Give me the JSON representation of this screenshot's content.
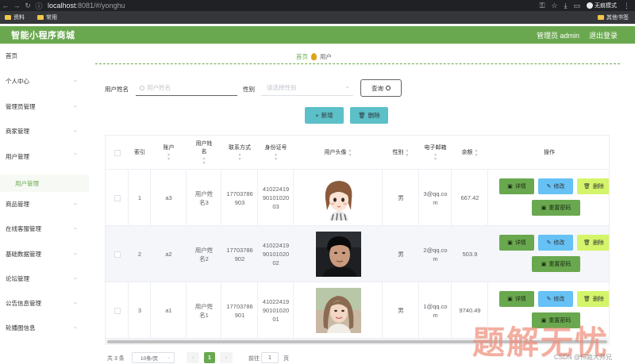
{
  "browser": {
    "url_host": "localhost",
    "url_path": ":8081/#/yonghu",
    "incognito_label": "无痕模式",
    "bookmarks": [
      "资料",
      "常用"
    ],
    "bookmarks_other": "其他书签"
  },
  "header": {
    "title": "智能小程序商城",
    "user": "管理员 admin",
    "logout": "退出登录"
  },
  "sidebar": {
    "items": [
      {
        "label": "首页",
        "has_children": false
      },
      {
        "label": "个人中心",
        "has_children": true
      },
      {
        "label": "管理员管理",
        "has_children": true
      },
      {
        "label": "商家管理",
        "has_children": true
      },
      {
        "label": "用户管理",
        "has_children": true
      },
      {
        "label": "商品管理",
        "has_children": true
      },
      {
        "label": "在线客服管理",
        "has_children": true
      },
      {
        "label": "基础数据管理",
        "has_children": true
      },
      {
        "label": "论坛管理",
        "has_children": true
      },
      {
        "label": "公告信息管理",
        "has_children": true
      },
      {
        "label": "轮播图信息",
        "has_children": true
      }
    ],
    "active_submenu": "用户管理"
  },
  "breadcrumb": {
    "home": "首页",
    "current": "用户"
  },
  "search": {
    "name_label": "用户姓名",
    "name_placeholder": "用户姓名",
    "gender_label": "性别",
    "gender_placeholder": "请选择性别",
    "query_button": "查询"
  },
  "actions": {
    "add": "新增",
    "delete": "删除"
  },
  "table": {
    "columns": [
      {
        "label": "",
        "sortable": false
      },
      {
        "label": "索引",
        "sortable": false
      },
      {
        "label": "账户",
        "sortable": true
      },
      {
        "label": "用户姓名",
        "sortable": true
      },
      {
        "label": "联系方式",
        "sortable": true
      },
      {
        "label": "身份证号",
        "sortable": true
      },
      {
        "label": "用户头像",
        "sortable": true
      },
      {
        "label": "性别",
        "sortable": true
      },
      {
        "label": "电子邮箱",
        "sortable": true
      },
      {
        "label": "余额",
        "sortable": true
      },
      {
        "label": "操作",
        "sortable": false
      }
    ],
    "rows": [
      {
        "index": "1",
        "account": "a3",
        "name": "用户姓名3",
        "phone": "17703786903",
        "id_card": "410224199010102003",
        "avatar": "cartoon-girl",
        "gender": "男",
        "email": "3@qq.com",
        "balance": "667.42"
      },
      {
        "index": "2",
        "account": "a2",
        "name": "用户姓名2",
        "phone": "17703786902",
        "id_card": "410224199010102002",
        "avatar": "man-photo",
        "gender": "男",
        "email": "2@qq.com",
        "balance": "503.9"
      },
      {
        "index": "3",
        "account": "a1",
        "name": "用户姓名1",
        "phone": "17703786901",
        "id_card": "410224199010102001",
        "avatar": "woman-photo",
        "gender": "男",
        "email": "1@qq.com",
        "balance": "9740.49"
      }
    ],
    "row_actions": {
      "detail": "详情",
      "edit": "修改",
      "delete": "删除",
      "reset": "重置密码"
    }
  },
  "pagination": {
    "total": "共 3 条",
    "page_size": "10条/页",
    "current_page": "1",
    "goto_label": "前往",
    "goto_value": "1",
    "page_unit": "页"
  },
  "watermark": {
    "text": "题解无忧",
    "credit": "CSDN @伟庭大师兄"
  },
  "colors": {
    "brand_green": "#6aa84f",
    "teal": "#5bc0c8",
    "edit_blue": "#66c1f5",
    "delete_lime": "#d4f46a"
  }
}
